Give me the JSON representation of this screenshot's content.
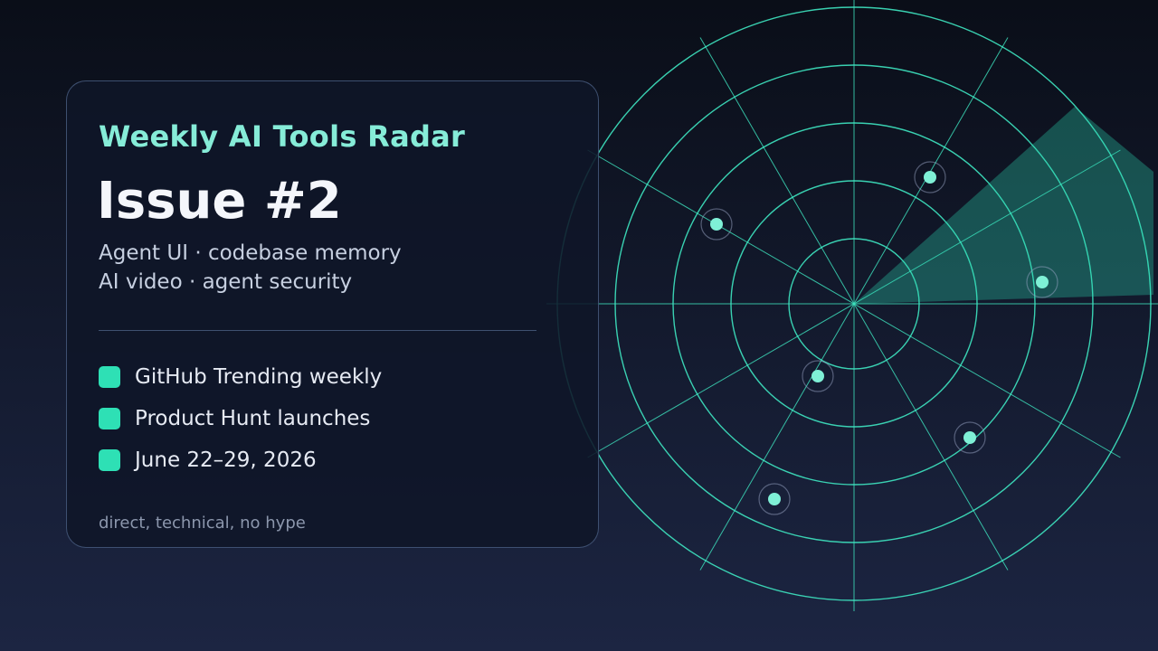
{
  "header": {
    "kicker": "Weekly AI Tools Radar",
    "issue": "Issue #2"
  },
  "topics": [
    "Agent UI · codebase memory",
    "AI video · agent security"
  ],
  "sources": [
    {
      "label": "GitHub Trending weekly"
    },
    {
      "label": "Product Hunt launches"
    },
    {
      "label": "June 22–29, 2026"
    }
  ],
  "tagline": "direct, technical, no hype",
  "colors": {
    "accent": "#2ee0b5",
    "kicker": "#86ecd8",
    "radar_line": "#3ee6c1",
    "blip": "#7ff0d6"
  }
}
